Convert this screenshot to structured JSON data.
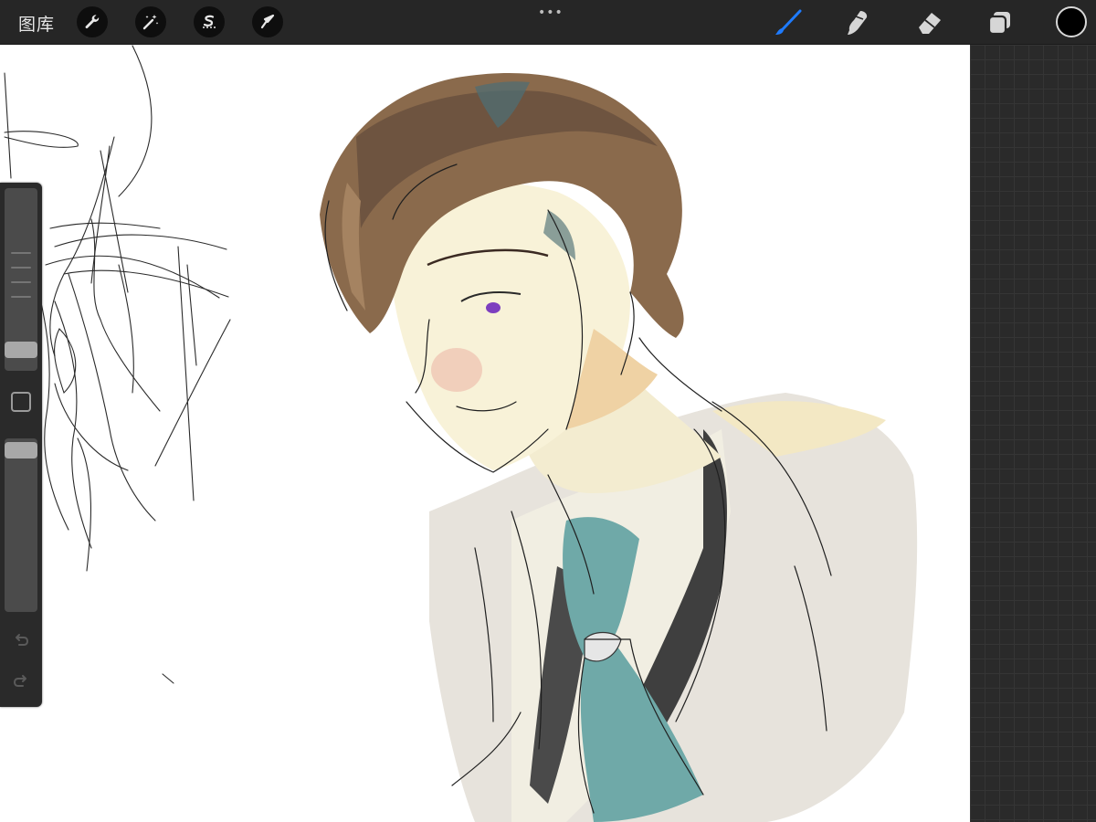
{
  "toolbar": {
    "gallery_label": "图库",
    "more_indicator": "•••",
    "left_tools": [
      "wrench-icon",
      "magic-wand-icon",
      "selection-icon",
      "transform-arrow-icon"
    ],
    "right_tools": [
      "brush-icon",
      "smudge-icon",
      "eraser-icon",
      "layers-icon"
    ],
    "active_tool": "brush",
    "current_color": "#000000",
    "accent_color": "#1e7bff"
  },
  "sidebar": {
    "controls": [
      "brush-size-slider",
      "modify-button",
      "brush-opacity-slider",
      "undo-icon",
      "redo-icon"
    ]
  }
}
